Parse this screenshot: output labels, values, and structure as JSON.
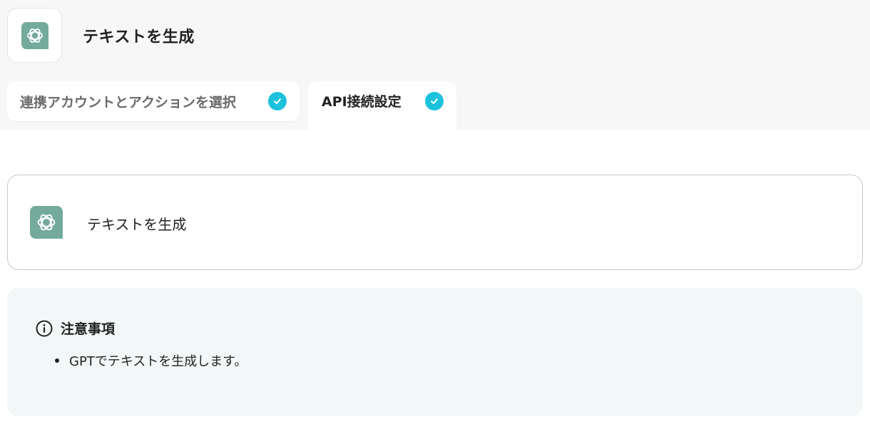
{
  "header": {
    "title": "テキストを生成",
    "app_icon": "openai-logo-icon"
  },
  "tabs": [
    {
      "label": "連携アカウントとアクションを選択",
      "completed": true,
      "active": false
    },
    {
      "label": "API接続設定",
      "completed": true,
      "active": true
    }
  ],
  "action_card": {
    "title": "テキストを生成",
    "icon": "openai-logo-icon"
  },
  "notice": {
    "title": "注意事項",
    "icon": "info-icon",
    "items": [
      "GPTでテキストを生成します。"
    ]
  },
  "colors": {
    "check": "#1cc2dc",
    "gpt_brand": "#74aa9c",
    "notice_bg": "#f1f8f7",
    "header_bg": "#f7f7f7"
  }
}
